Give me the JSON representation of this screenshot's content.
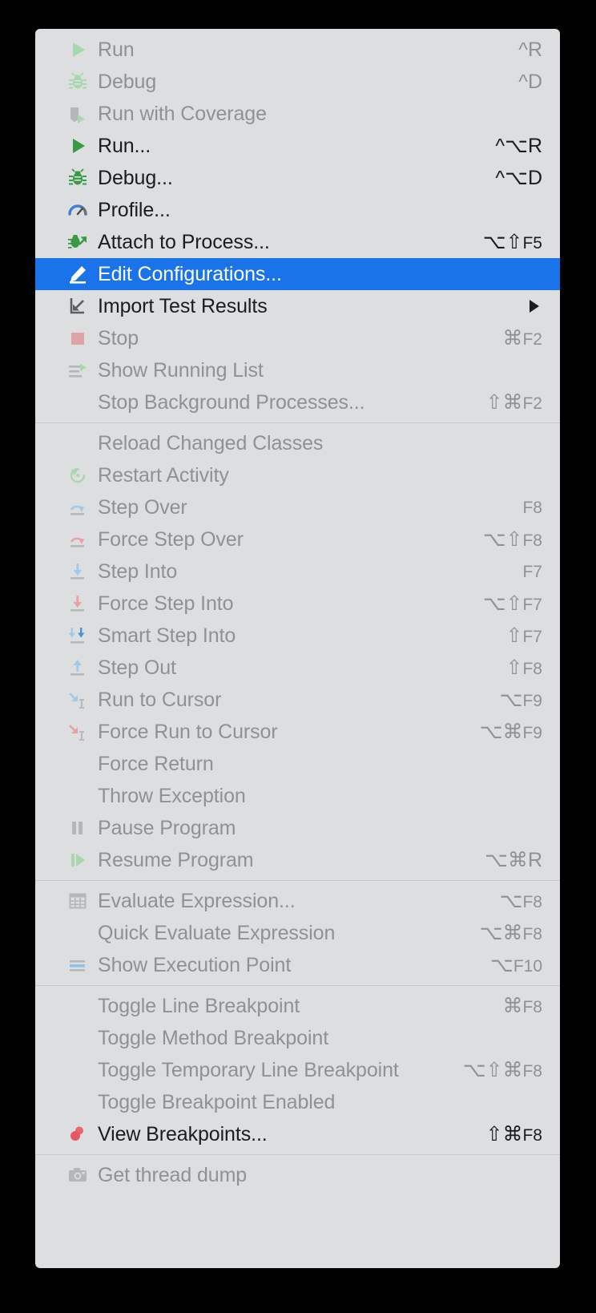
{
  "menu": {
    "name": "Run menu",
    "accent_selected": "#1a73e8",
    "background": "#dddee0",
    "text_enabled": "#1b1c1e",
    "text_disabled": "#8e9195",
    "groups": [
      {
        "items": [
          {
            "label": "Run",
            "shortcut": "^R",
            "mods": "^",
            "key": "R",
            "icon": "run-play-icon",
            "enabled": false
          },
          {
            "label": "Debug",
            "shortcut": "^D",
            "mods": "^",
            "key": "D",
            "icon": "debug-bug-icon",
            "enabled": false
          },
          {
            "label": "Run with Coverage",
            "shortcut": "",
            "mods": "",
            "key": "",
            "icon": "run-with-coverage-icon",
            "enabled": false
          },
          {
            "label": "Run...",
            "shortcut": "^⌥R",
            "mods": "^⌥",
            "key": "R",
            "icon": "run-play-icon",
            "enabled": true
          },
          {
            "label": "Debug...",
            "shortcut": "^⌥D",
            "mods": "^⌥",
            "key": "D",
            "icon": "debug-bug-icon",
            "enabled": true
          },
          {
            "label": "Profile...",
            "shortcut": "",
            "mods": "",
            "key": "",
            "icon": "profile-gauge-icon",
            "enabled": true
          },
          {
            "label": "Attach to Process...",
            "shortcut": "⌥⇧F5",
            "mods": "⌥⇧",
            "key": "F5",
            "icon": "attach-process-icon",
            "enabled": true
          },
          {
            "label": "Edit Configurations...",
            "shortcut": "",
            "mods": "",
            "key": "",
            "icon": "edit-pencil-icon",
            "enabled": true,
            "selected": true
          },
          {
            "label": "Import Test Results",
            "shortcut": "",
            "mods": "",
            "key": "",
            "icon": "import-test-results-icon",
            "enabled": true,
            "submenu": true
          },
          {
            "label": "Stop",
            "shortcut": "⌘F2",
            "mods": "⌘",
            "key": "F2",
            "icon": "stop-square-icon",
            "enabled": false
          },
          {
            "label": "Show Running List",
            "shortcut": "",
            "mods": "",
            "key": "",
            "icon": "show-running-list-icon",
            "enabled": false
          },
          {
            "label": "Stop Background Processes...",
            "shortcut": "⇧⌘F2",
            "mods": "⇧⌘",
            "key": "F2",
            "icon": "",
            "enabled": false
          }
        ]
      },
      {
        "items": [
          {
            "label": "Reload Changed Classes",
            "shortcut": "",
            "mods": "",
            "key": "",
            "icon": "",
            "enabled": false
          },
          {
            "label": "Restart Activity",
            "shortcut": "",
            "mods": "",
            "key": "",
            "icon": "restart-activity-icon",
            "enabled": false
          },
          {
            "label": "Step Over",
            "shortcut": "F8",
            "mods": "",
            "key": "F8",
            "icon": "step-over-icon",
            "enabled": false
          },
          {
            "label": "Force Step Over",
            "shortcut": "⌥⇧F8",
            "mods": "⌥⇧",
            "key": "F8",
            "icon": "force-step-over-icon",
            "enabled": false
          },
          {
            "label": "Step Into",
            "shortcut": "F7",
            "mods": "",
            "key": "F7",
            "icon": "step-into-icon",
            "enabled": false
          },
          {
            "label": "Force Step Into",
            "shortcut": "⌥⇧F7",
            "mods": "⌥⇧",
            "key": "F7",
            "icon": "force-step-into-icon",
            "enabled": false
          },
          {
            "label": "Smart Step Into",
            "shortcut": "⇧F7",
            "mods": "⇧",
            "key": "F7",
            "icon": "smart-step-into-icon",
            "enabled": false
          },
          {
            "label": "Step Out",
            "shortcut": "⇧F8",
            "mods": "⇧",
            "key": "F8",
            "icon": "step-out-icon",
            "enabled": false
          },
          {
            "label": "Run to Cursor",
            "shortcut": "⌥F9",
            "mods": "⌥",
            "key": "F9",
            "icon": "run-to-cursor-icon",
            "enabled": false
          },
          {
            "label": "Force Run to Cursor",
            "shortcut": "⌥⌘F9",
            "mods": "⌥⌘",
            "key": "F9",
            "icon": "force-run-to-cursor-icon",
            "enabled": false
          },
          {
            "label": "Force Return",
            "shortcut": "",
            "mods": "",
            "key": "",
            "icon": "",
            "enabled": false
          },
          {
            "label": "Throw Exception",
            "shortcut": "",
            "mods": "",
            "key": "",
            "icon": "",
            "enabled": false
          },
          {
            "label": "Pause Program",
            "shortcut": "",
            "mods": "",
            "key": "",
            "icon": "pause-icon",
            "enabled": false
          },
          {
            "label": "Resume Program",
            "shortcut": "⌥⌘R",
            "mods": "⌥⌘",
            "key": "R",
            "icon": "resume-icon",
            "enabled": false
          }
        ]
      },
      {
        "items": [
          {
            "label": "Evaluate Expression...",
            "shortcut": "⌥F8",
            "mods": "⌥",
            "key": "F8",
            "icon": "evaluate-expression-icon",
            "enabled": false
          },
          {
            "label": "Quick Evaluate Expression",
            "shortcut": "⌥⌘F8",
            "mods": "⌥⌘",
            "key": "F8",
            "icon": "",
            "enabled": false
          },
          {
            "label": "Show Execution Point",
            "shortcut": "⌥F10",
            "mods": "⌥",
            "key": "F10",
            "icon": "show-execution-point-icon",
            "enabled": false
          }
        ]
      },
      {
        "items": [
          {
            "label": "Toggle Line Breakpoint",
            "shortcut": "⌘F8",
            "mods": "⌘",
            "key": "F8",
            "icon": "",
            "enabled": false
          },
          {
            "label": "Toggle Method Breakpoint",
            "shortcut": "",
            "mods": "",
            "key": "",
            "icon": "",
            "enabled": false
          },
          {
            "label": "Toggle Temporary Line Breakpoint",
            "shortcut": "⌥⇧⌘F8",
            "mods": "⌥⇧⌘",
            "key": "F8",
            "icon": "",
            "enabled": false
          },
          {
            "label": "Toggle Breakpoint Enabled",
            "shortcut": "",
            "mods": "",
            "key": "",
            "icon": "",
            "enabled": false
          },
          {
            "label": "View Breakpoints...",
            "shortcut": "⇧⌘F8",
            "mods": "⇧⌘",
            "key": "F8",
            "icon": "view-breakpoints-icon",
            "enabled": true
          }
        ]
      },
      {
        "items": [
          {
            "label": "Get thread dump",
            "shortcut": "",
            "mods": "",
            "key": "",
            "icon": "thread-dump-camera-icon",
            "enabled": false
          }
        ]
      }
    ]
  }
}
